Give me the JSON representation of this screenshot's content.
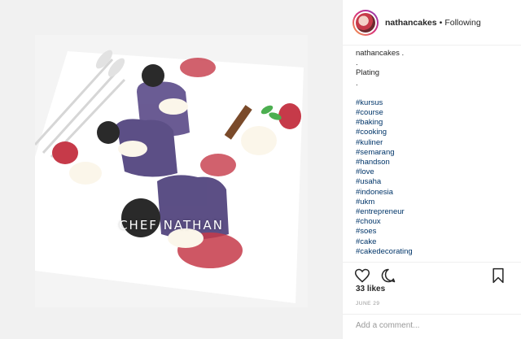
{
  "post": {
    "username": "nathancakes",
    "separator": "•",
    "follow_status": "Following",
    "image_watermark": "CHEF NATHAN"
  },
  "caption": {
    "username_line": "nathancakes .",
    "lines": [
      ".",
      "Plating",
      "."
    ],
    "hashtags": [
      "#kursus",
      "#course",
      "#baking",
      "#cooking",
      "#kuliner",
      "#semarang",
      "#handson",
      "#love",
      "#usaha",
      "#indonesia",
      "#ukm",
      "#entrepreneur",
      "#choux",
      "#soes",
      "#cake",
      "#cakedecorating"
    ]
  },
  "actions": {
    "icons": [
      "heart-icon",
      "comment-icon",
      "bookmark-icon"
    ]
  },
  "stats": {
    "likes": "33 likes",
    "date": "JUNE 29"
  },
  "comment": {
    "placeholder": "Add a comment..."
  },
  "colors": {
    "hashtag": "#003569",
    "border": "#efefef",
    "muted": "#999999",
    "text": "#262626"
  }
}
